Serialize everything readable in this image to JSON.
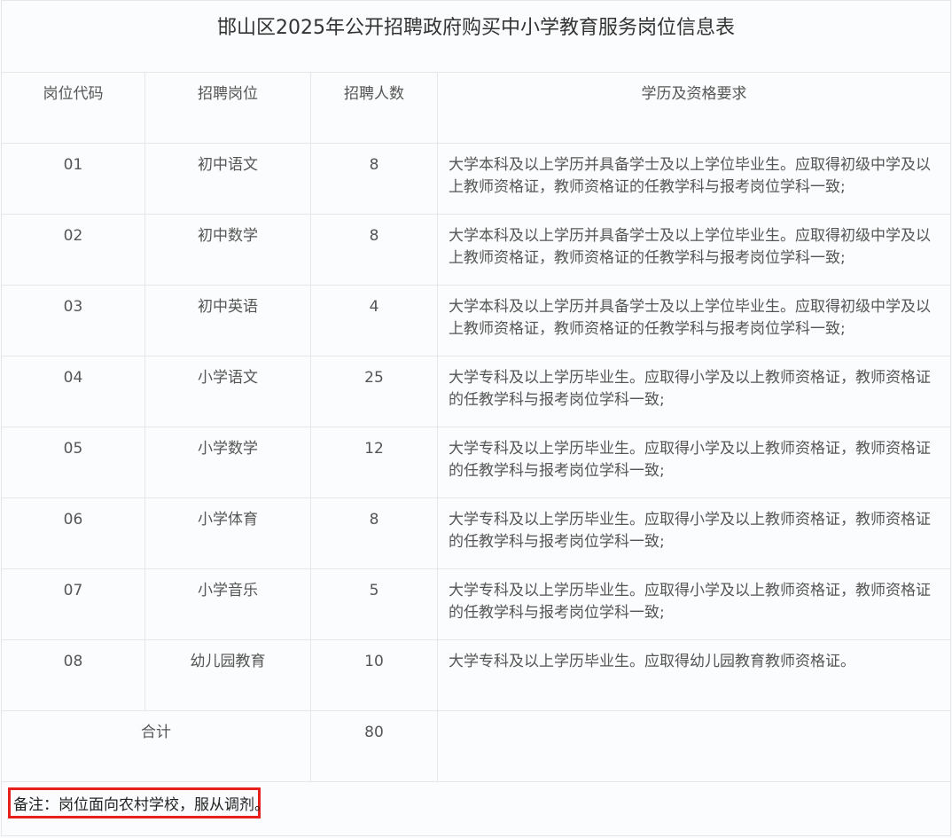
{
  "title": "邯山区2025年公开招聘政府购买中小学教育服务岗位信息表",
  "headers": {
    "code": "岗位代码",
    "position": "招聘岗位",
    "count": "招聘人数",
    "requirements": "学历及资格要求"
  },
  "rows": [
    {
      "code": "01",
      "position": "初中语文",
      "count": "8",
      "requirements": "大学本科及以上学历并具备学士及以上学位毕业生。应取得初级中学及以上教师资格证，教师资格证的任教学科与报考岗位学科一致;"
    },
    {
      "code": "02",
      "position": "初中数学",
      "count": "8",
      "requirements": "大学本科及以上学历并具备学士及以上学位毕业生。应取得初级中学及以上教师资格证，教师资格证的任教学科与报考岗位学科一致;"
    },
    {
      "code": "03",
      "position": "初中英语",
      "count": "4",
      "requirements": "大学本科及以上学历并具备学士及以上学位毕业生。应取得初级中学及以上教师资格证，教师资格证的任教学科与报考岗位学科一致;"
    },
    {
      "code": "04",
      "position": "小学语文",
      "count": "25",
      "requirements": "大学专科及以上学历毕业生。应取得小学及以上教师资格证，教师资格证的任教学科与报考岗位学科一致;"
    },
    {
      "code": "05",
      "position": "小学数学",
      "count": "12",
      "requirements": "大学专科及以上学历毕业生。应取得小学及以上教师资格证，教师资格证的任教学科与报考岗位学科一致;"
    },
    {
      "code": "06",
      "position": "小学体育",
      "count": "8",
      "requirements": "大学专科及以上学历毕业生。应取得小学及以上教师资格证，教师资格证的任教学科与报考岗位学科一致;"
    },
    {
      "code": "07",
      "position": "小学音乐",
      "count": "5",
      "requirements": "大学专科及以上学历毕业生。应取得小学及以上教师资格证，教师资格证的任教学科与报考岗位学科一致;"
    },
    {
      "code": "08",
      "position": "幼儿园教育",
      "count": "10",
      "requirements": "大学专科及以上学历毕业生。应取得幼儿园教育教师资格证。"
    }
  ],
  "total": {
    "label": "合计",
    "count": "80"
  },
  "note": "备注：岗位面向农村学校，服从调剂。",
  "colors": {
    "highlight_border": "#e8201c",
    "grid_line": "#e4e8ec"
  }
}
